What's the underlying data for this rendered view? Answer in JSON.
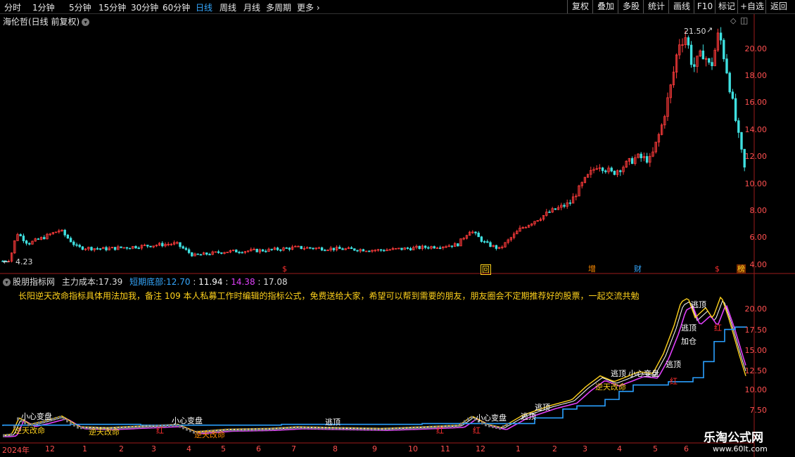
{
  "toolbar": {
    "timeframes": [
      "分时",
      "1分钟",
      "5分钟",
      "15分钟",
      "30分钟",
      "60分钟",
      "日线",
      "周线",
      "月线",
      "多周期",
      "更多"
    ],
    "active": "日线",
    "right_buttons": [
      "复权",
      "叠加",
      "多股",
      "统计",
      "画线",
      "F10",
      "标记",
      "+自选",
      "返回"
    ]
  },
  "chart": {
    "title": "海伦哲(日线 前复权)",
    "high_label": "21.50",
    "low_label": "4.23",
    "y_ticks": [
      "20.00",
      "18.00",
      "16.00",
      "14.00",
      "12.00",
      "10.00",
      "8.00",
      "6.00",
      "4.00"
    ],
    "event_markers": [
      "$",
      "回",
      "增",
      "财",
      "$",
      "榜"
    ]
  },
  "indicator": {
    "name": "股朋指标网",
    "main_cost_label": "主力成本:",
    "main_cost_value": "17.39",
    "short_bottom_label": "短期底部:",
    "short_bottom_value": "12.70",
    "v3": "11.94",
    "v4": "14.38",
    "v5": "17.08",
    "ad_text": "长阳逆天改命指标具体用法加我，备注 109 本人私募工作时编辑的指标公式，免费送给大家，希望可以帮到需要的朋友，朋友圈会不定期推荐好的股票，一起交流共勉",
    "y_ticks": [
      "20.00",
      "17.50",
      "15.00",
      "12.50",
      "10.00",
      "7.50"
    ],
    "labels": {
      "escape_top": "逃顶",
      "add_position": "加仓",
      "careful": "小心变盘",
      "red": "红",
      "reversal": "逆天改命"
    }
  },
  "x_axis": [
    "2024年",
    "12",
    "1",
    "2",
    "3",
    "4",
    "5",
    "6",
    "7",
    "8",
    "9",
    "10",
    "11",
    "12",
    "1",
    "2",
    "3",
    "4",
    "5",
    "6"
  ],
  "watermark": {
    "name": "乐淘公式网",
    "url": "www.60lt.com"
  }
}
